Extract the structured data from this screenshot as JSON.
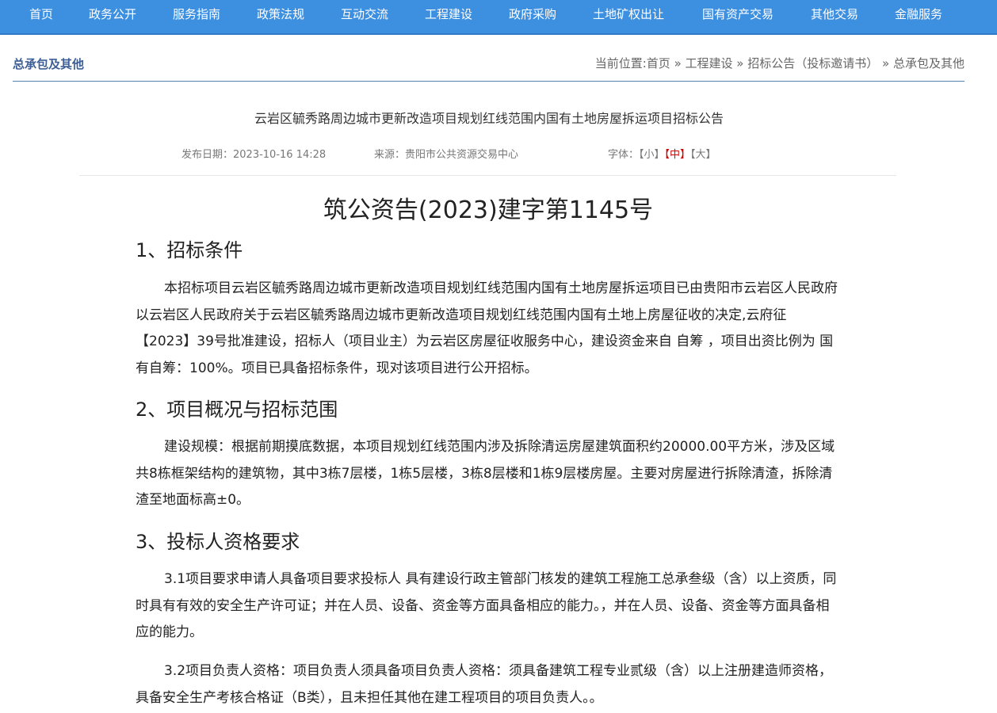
{
  "nav": {
    "items": [
      "首页",
      "政务公开",
      "服务指南",
      "政策法规",
      "互动交流",
      "工程建设",
      "政府采购",
      "土地矿权出让",
      "国有资产交易",
      "其他交易",
      "金融服务"
    ]
  },
  "header": {
    "section": "总承包及其他",
    "breadcrumb": {
      "prefix": "当前位置:",
      "home": "首页",
      "sep": " » ",
      "level1": "工程建设",
      "level2": "招标公告（投标邀请书）",
      "level3": "总承包及其他"
    }
  },
  "article": {
    "title": "云岩区毓秀路周边城市更新改造项目规划红线范围内国有土地房屋拆运项目招标公告",
    "meta": {
      "date_label": "发布日期：",
      "date": "2023-10-16 14:28",
      "source_label": "来源：",
      "source": "贵阳市公共资源交易中心",
      "font_label": "字体：",
      "size_small": "【小】",
      "size_medium": "【中】",
      "size_large": "【大】"
    },
    "doc_number": "筑公资告(2023)建字第1145号",
    "sections": [
      {
        "heading": "1、招标条件",
        "paragraphs": [
          "本招标项目云岩区毓秀路周边城市更新改造项目规划红线范围内国有土地房屋拆运项目已由贵阳市云岩区人民政府以云岩区人民政府关于云岩区毓秀路周边城市更新改造项目规划红线范围内国有土地上房屋征收的决定,云府征【2023】39号批准建设，招标人（项目业主）为云岩区房屋征收服务中心，建设资金来自 自筹 ，项目出资比例为 国有自筹：100%。项目已具备招标条件，现对该项目进行公开招标。"
        ]
      },
      {
        "heading": "2、项目概况与招标范围",
        "paragraphs": [
          "建设规模：根据前期摸底数据，本项目规划红线范围内涉及拆除清运房屋建筑面积约20000.00平方米，涉及区域共8栋框架结构的建筑物，其中3栋7层楼，1栋5层楼，3栋8层楼和1栋9层楼房屋。主要对房屋进行拆除清渣，拆除清渣至地面标高±0。"
        ]
      },
      {
        "heading": "3、投标人资格要求",
        "paragraphs": [
          "3.1项目要求申请人具备项目要求投标人 具有建设行政主管部门核发的建筑工程施工总承叁级（含）以上资质，同时具有有效的安全生产许可证；并在人员、设备、资金等方面具备相应的能力。，并在人员、设备、资金等方面具备相应的能力。",
          "3.2项目负责人资格：项目负责人须具备项目负责人资格：须具备建筑工程专业贰级（含）以上注册建造师资格，具备安全生产考核合格证（B类），且未担任其他在建工程项目的项目负责人。。"
        ]
      }
    ]
  }
}
